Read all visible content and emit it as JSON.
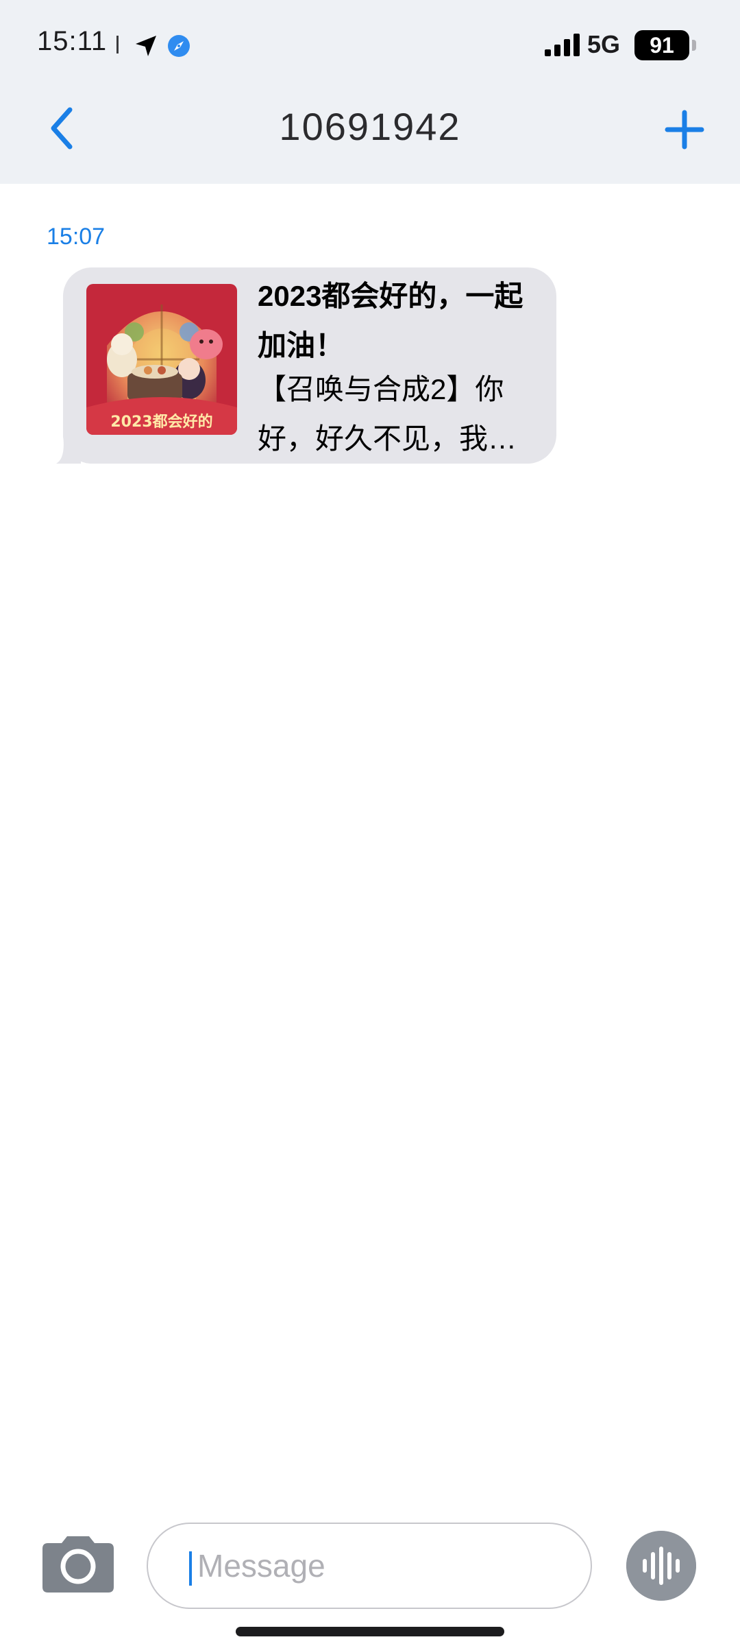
{
  "status_bar": {
    "time": "15:11",
    "network": "5G",
    "battery_level": "91",
    "signal_bars": 4,
    "icons": [
      "location-arrow-icon",
      "compass-icon",
      "signal-bars-icon",
      "battery-icon"
    ]
  },
  "nav": {
    "title": "10691942",
    "back_icon": "chevron-left-icon",
    "add_icon": "plus-icon",
    "accent_color": "#1a7fe6"
  },
  "conversation": {
    "messages": [
      {
        "timestamp": "15:07",
        "card_title": "2023都会好的，一起加油！",
        "card_body": "【召唤与合成2】你好，好久不见，我…",
        "thumbnail_caption": "2023都会好的"
      }
    ]
  },
  "input_bar": {
    "placeholder": "Message",
    "camera_icon": "camera-icon",
    "voice_icon": "voice-waveform-icon"
  },
  "colors": {
    "header_background": "#eef1f5",
    "bubble_background": "#e5e5ea",
    "accent": "#1a7fe6"
  }
}
